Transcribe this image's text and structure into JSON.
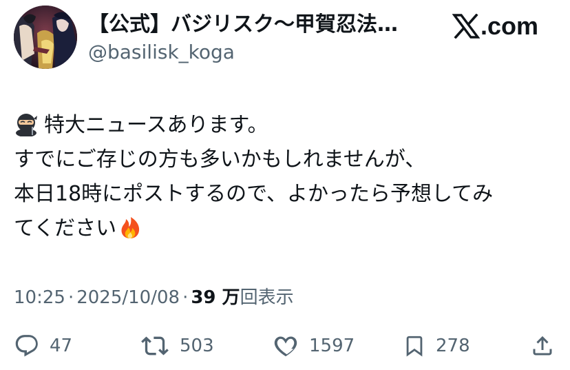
{
  "author": {
    "display_name": "【公式】バジリスク〜甲賀忍法…",
    "handle": "@basilisk_koga"
  },
  "brand": {
    "label": ".com"
  },
  "post": {
    "lines": [
      "特大ニュースあります。",
      "すでにご存じの方も多いかもしれませんが、",
      "本日18時にポストするので、よかったら予想してみ",
      "てください"
    ],
    "lead_emoji": "ninja-emoji",
    "trail_emoji": "fire-emoji"
  },
  "meta": {
    "time": "10:25",
    "separator": "·",
    "date": "2025/10/08",
    "views_number": "39 万",
    "views_label": "回表示"
  },
  "actions": {
    "replies": "47",
    "reposts": "503",
    "likes": "1597",
    "bookmarks": "278"
  },
  "colors": {
    "text": "#0f1419",
    "secondary": "#536471",
    "background": "#ffffff"
  },
  "icons": [
    "reply-icon",
    "repost-icon",
    "like-icon",
    "bookmark-icon",
    "share-icon"
  ]
}
